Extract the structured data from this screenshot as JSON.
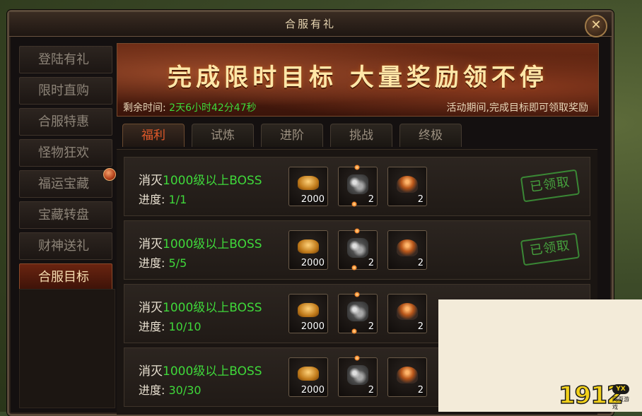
{
  "window": {
    "title": "合服有礼",
    "close_label": "✕"
  },
  "sidebar": {
    "items": [
      {
        "label": "登陆有礼",
        "active": false
      },
      {
        "label": "限时直购",
        "active": false
      },
      {
        "label": "合服特惠",
        "active": false
      },
      {
        "label": "怪物狂欢",
        "active": false
      },
      {
        "label": "福运宝藏",
        "active": false,
        "badge": true
      },
      {
        "label": "宝藏转盘",
        "active": false
      },
      {
        "label": "财神送礼",
        "active": false
      },
      {
        "label": "合服目标",
        "active": true
      }
    ]
  },
  "banner": {
    "slogan": "完成限时目标 大量奖励领不停",
    "time_label": "剩余时间:",
    "time_value": "2天6小时42分47秒",
    "note": "活动期间,完成目标即可领取奖励"
  },
  "tabs": [
    {
      "label": "福利",
      "active": true
    },
    {
      "label": "试炼",
      "active": false
    },
    {
      "label": "进阶",
      "active": false
    },
    {
      "label": "挑战",
      "active": false
    },
    {
      "label": "终极",
      "active": false
    }
  ],
  "quests": [
    {
      "desc_prefix": "消灭",
      "desc_highlight": "1000级以上BOSS",
      "progress_label": "进度:",
      "progress_value": "1/1",
      "status": "已领取",
      "rewards": [
        {
          "icon": "gold-ingot-icon",
          "qty": "2000"
        },
        {
          "icon": "ore-icon",
          "qty": "2"
        },
        {
          "icon": "chest-icon",
          "qty": "2"
        }
      ]
    },
    {
      "desc_prefix": "消灭",
      "desc_highlight": "1000级以上BOSS",
      "progress_label": "进度:",
      "progress_value": "5/5",
      "status": "已领取",
      "rewards": [
        {
          "icon": "gold-ingot-icon",
          "qty": "2000"
        },
        {
          "icon": "ore-icon",
          "qty": "2"
        },
        {
          "icon": "chest-icon",
          "qty": "2"
        }
      ]
    },
    {
      "desc_prefix": "消灭",
      "desc_highlight": "1000级以上BOSS",
      "progress_label": "进度:",
      "progress_value": "10/10",
      "status": "",
      "rewards": [
        {
          "icon": "gold-ingot-icon",
          "qty": "2000"
        },
        {
          "icon": "ore-icon",
          "qty": "2"
        },
        {
          "icon": "chest-icon",
          "qty": "2"
        }
      ]
    },
    {
      "desc_prefix": "消灭",
      "desc_highlight": "1000级以上BOSS",
      "progress_label": "进度:",
      "progress_value": "30/30",
      "status": "",
      "rewards": [
        {
          "icon": "gold-ingot-icon",
          "qty": "2000"
        },
        {
          "icon": "ore-icon",
          "qty": "2"
        },
        {
          "icon": "chest-icon",
          "qty": "2"
        }
      ]
    }
  ],
  "watermark": {
    "number": "1912",
    "badge": "YX",
    "sub": "网页游戏"
  }
}
